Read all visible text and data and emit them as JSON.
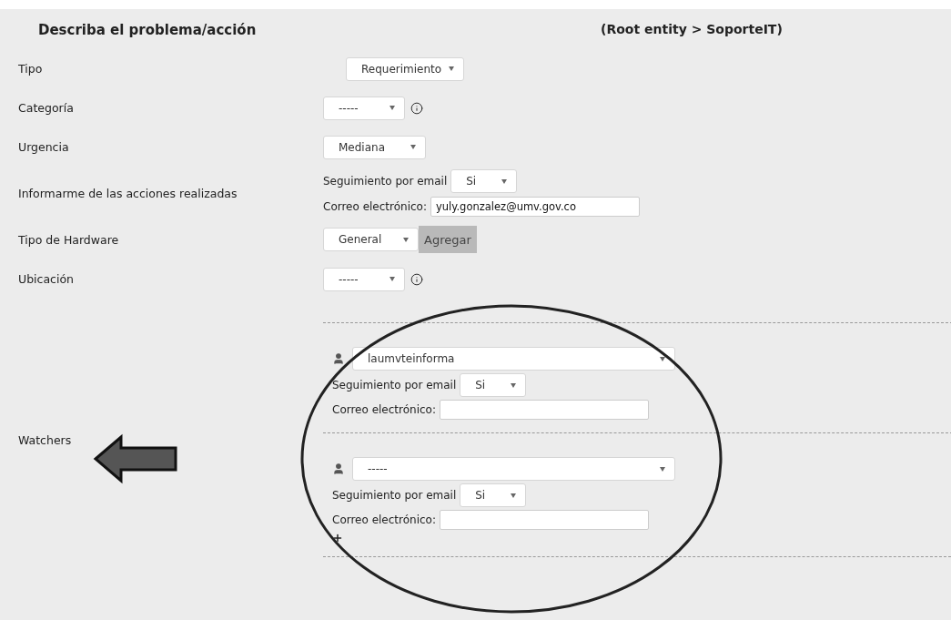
{
  "header": {
    "title": "Describa el problema/acción",
    "entity": "(Root entity > SoporteIT)"
  },
  "fields": [
    {
      "kind": "select",
      "label": "Tipo",
      "value": "Requerimiento",
      "info": false
    },
    {
      "kind": "select",
      "label": "Categoría",
      "value": "-----",
      "info": true
    },
    {
      "kind": "select",
      "label": "Urgencia",
      "value": "Mediana",
      "info": false
    },
    {
      "kind": "followup",
      "label": "Informarme de las acciones realizadas",
      "followup_label": "Seguimiento por email",
      "followup_value": "Si",
      "email_label": "Correo electrónico:",
      "email_value": "yuly.gonzalez@umv.gov.co"
    },
    {
      "kind": "select_add",
      "label": "Tipo de Hardware",
      "value": "General",
      "button": "Agregar"
    },
    {
      "kind": "select",
      "label": "Ubicación",
      "value": "-----",
      "info": true
    }
  ],
  "watchers": {
    "label": "Watchers",
    "items": [
      {
        "user": "laumvteinforma",
        "followup_label": "Seguimiento por email",
        "followup_value": "Si",
        "email_label": "Correo electrónico:"
      },
      {
        "user": "-----",
        "followup_label": "Seguimiento por email",
        "followup_value": "Si",
        "email_label": "Correo electrónico:"
      }
    ]
  }
}
